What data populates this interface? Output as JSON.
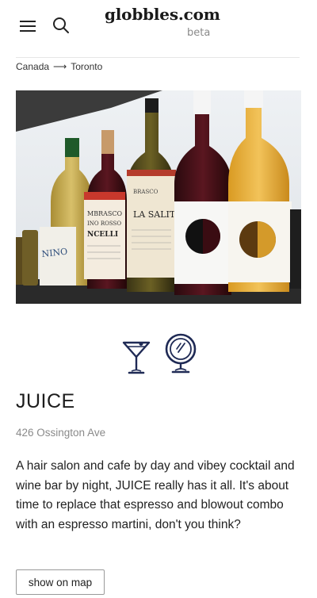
{
  "header": {
    "site_title": "globbles.com",
    "site_badge": "beta",
    "menu_icon": "hamburger-menu-icon",
    "search_icon": "search-icon"
  },
  "breadcrumb": {
    "items": [
      "Canada",
      "Toronto"
    ],
    "separator": "⟶"
  },
  "photo": {
    "subject": "wine-bottles-photo"
  },
  "features": {
    "icons": [
      "cocktail-glass-icon",
      "hand-mirror-icon"
    ],
    "icon_color": "#1f2a55"
  },
  "venue": {
    "name": "JUICE",
    "address": "426 Ossington Ave",
    "description": "A hair salon and cafe by day and vibey cocktail and wine bar by night, JUICE really has it all. It's about time to replace that espresso and blowout combo with an espresso martini, don't you think?",
    "map_button_label": "show on map"
  }
}
